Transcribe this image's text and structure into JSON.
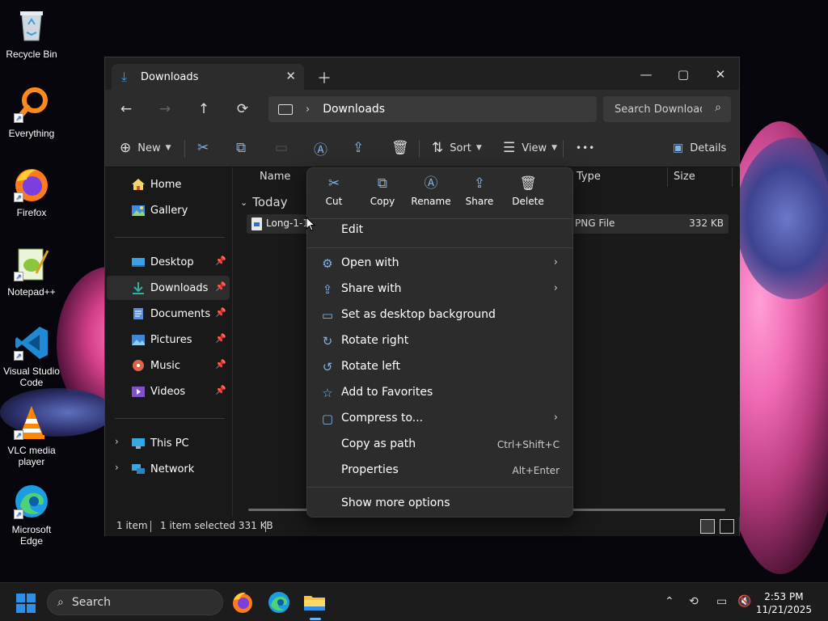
{
  "desktop": {
    "icons": [
      {
        "label": "Recycle Bin",
        "icon": "recycle-bin-icon"
      },
      {
        "label": "Everything",
        "icon": "everything-search-icon"
      },
      {
        "label": "Firefox",
        "icon": "firefox-icon"
      },
      {
        "label": "Notepad++",
        "icon": "notepad-plus-plus-icon"
      },
      {
        "label": "Visual Studio Code",
        "icon": "vscode-icon"
      },
      {
        "label": "VLC media player",
        "icon": "vlc-icon"
      },
      {
        "label": "Microsoft Edge",
        "icon": "edge-icon"
      }
    ]
  },
  "window": {
    "tab_title": "Downloads",
    "controls": {
      "minimize": "—",
      "maximize": "▢",
      "close": "✕"
    },
    "nav": {
      "back": "←",
      "forward": "→",
      "up": "↑",
      "refresh": "⟳"
    },
    "address": {
      "crumb": "Downloads"
    },
    "search": {
      "placeholder": "Search Downloads"
    },
    "commandbar": {
      "new_label": "New",
      "sort_label": "Sort",
      "view_label": "View",
      "more": "•••",
      "details_label": "Details"
    },
    "sidebar": {
      "top": [
        {
          "label": "Home",
          "icon": "home-icon"
        },
        {
          "label": "Gallery",
          "icon": "gallery-icon"
        }
      ],
      "pinned": [
        {
          "label": "Desktop",
          "icon": "desktop-folder-icon"
        },
        {
          "label": "Downloads",
          "icon": "downloads-folder-icon",
          "selected": true
        },
        {
          "label": "Documents",
          "icon": "documents-folder-icon"
        },
        {
          "label": "Pictures",
          "icon": "pictures-folder-icon"
        },
        {
          "label": "Music",
          "icon": "music-folder-icon"
        },
        {
          "label": "Videos",
          "icon": "videos-folder-icon"
        }
      ],
      "bottom": [
        {
          "label": "This PC",
          "icon": "this-pc-icon"
        },
        {
          "label": "Network",
          "icon": "network-icon"
        }
      ]
    },
    "columns": {
      "name": "Name",
      "type": "Type",
      "size": "Size"
    },
    "group": "Today",
    "files": [
      {
        "name": "Long-1-1(",
        "type": "PNG File",
        "size": "332 KB"
      }
    ],
    "status": {
      "count": "1 item",
      "selected": "1 item selected  331 KB"
    }
  },
  "context_menu": {
    "quick_actions": [
      {
        "label": "Cut",
        "icon": "scissors-icon",
        "glyph": "✂"
      },
      {
        "label": "Copy",
        "icon": "copy-icon",
        "glyph": "⧉"
      },
      {
        "label": "Rename",
        "icon": "rename-icon",
        "glyph": "Ⓐ"
      },
      {
        "label": "Share",
        "icon": "share-icon",
        "glyph": "⇪"
      },
      {
        "label": "Delete",
        "icon": "trash-icon",
        "glyph": "🗑"
      }
    ],
    "items": [
      {
        "label": "Edit",
        "icon": "",
        "arrow": false,
        "shortcut": ""
      },
      {
        "label": "Open with",
        "icon": "open-with-icon",
        "arrow": true,
        "shortcut": ""
      },
      {
        "label": "Share with",
        "icon": "share-with-icon",
        "arrow": true,
        "shortcut": ""
      },
      {
        "label": "Set as desktop background",
        "icon": "desktop-background-icon",
        "arrow": false,
        "shortcut": ""
      },
      {
        "label": "Rotate right",
        "icon": "rotate-right-icon",
        "arrow": false,
        "shortcut": ""
      },
      {
        "label": "Rotate left",
        "icon": "rotate-left-icon",
        "arrow": false,
        "shortcut": ""
      },
      {
        "label": "Add to Favorites",
        "icon": "star-icon",
        "arrow": false,
        "shortcut": ""
      },
      {
        "label": "Compress to...",
        "icon": "compress-icon",
        "arrow": true,
        "shortcut": ""
      },
      {
        "label": "Copy as path",
        "icon": "",
        "arrow": false,
        "shortcut": "Ctrl+Shift+C"
      },
      {
        "label": "Properties",
        "icon": "",
        "arrow": false,
        "shortcut": "Alt+Enter"
      }
    ],
    "footer": "Show more options"
  },
  "taskbar": {
    "search_label": "Search",
    "apps": [
      "firefox-icon",
      "edge-icon",
      "file-explorer-icon"
    ],
    "time": "2:53 PM",
    "date": "11/21/2025"
  },
  "colors": {
    "accent": "#2f8fe6",
    "window_bg": "#191919",
    "menu_bg": "#2c2c2c"
  }
}
